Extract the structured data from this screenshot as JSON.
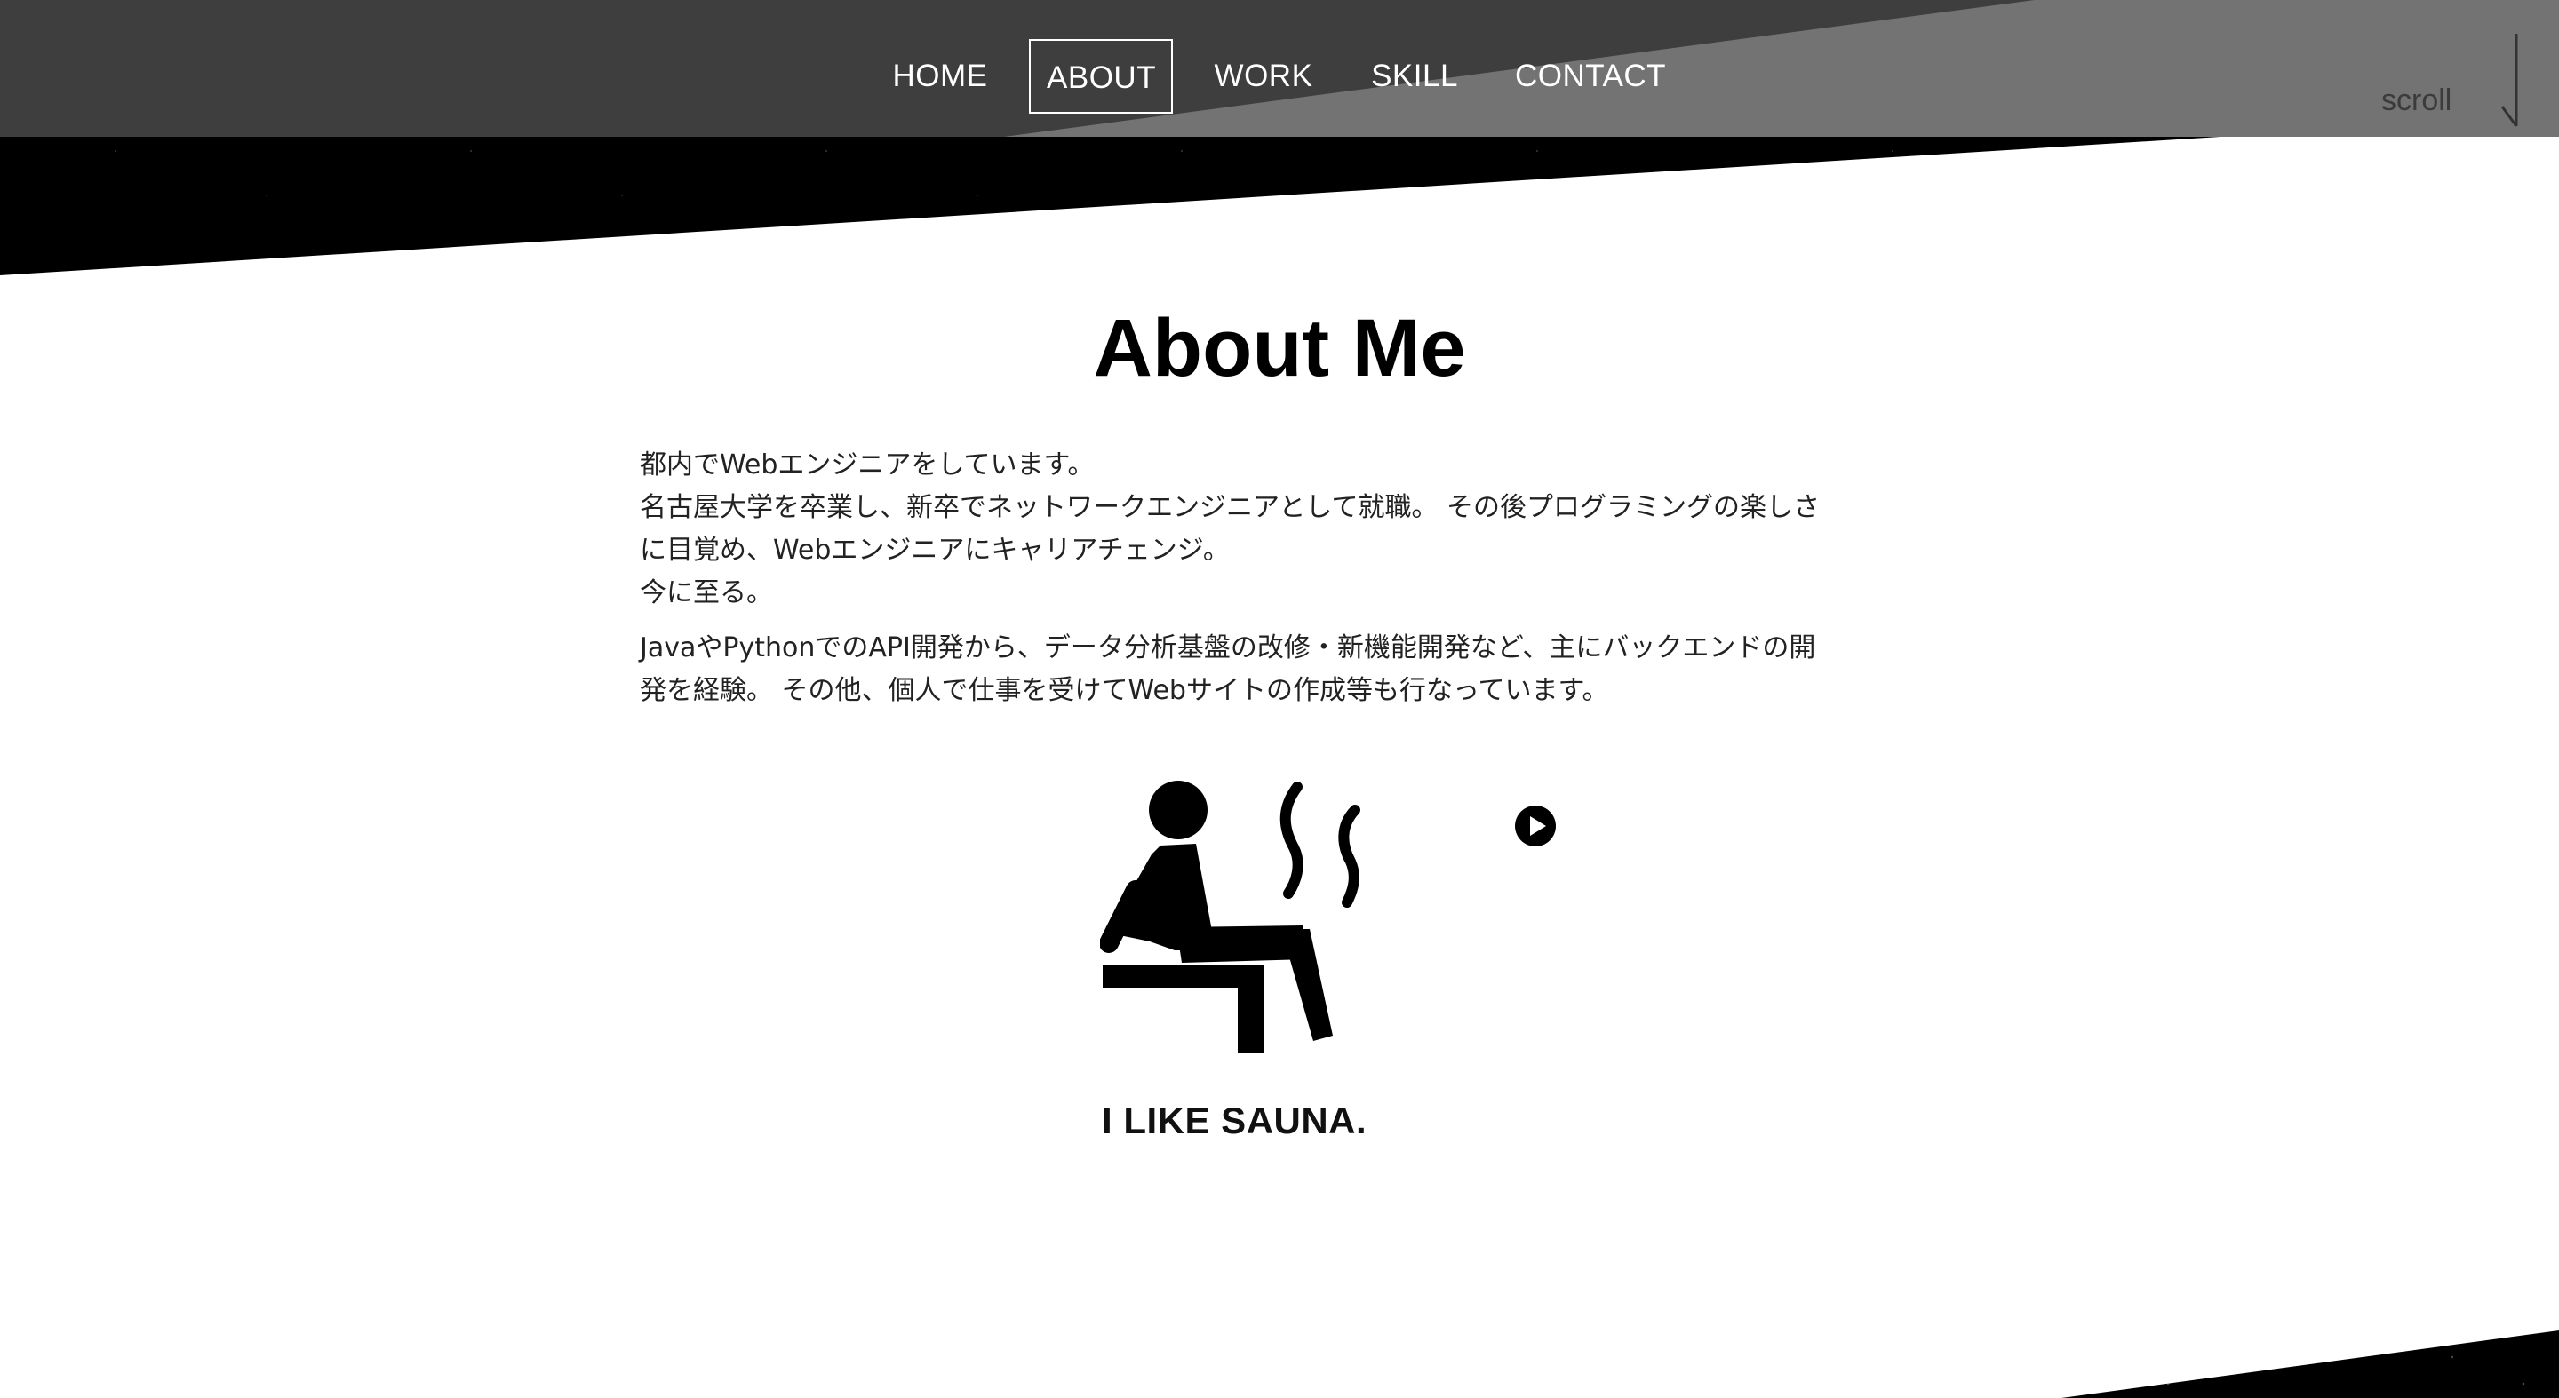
{
  "nav": {
    "items": [
      {
        "label": "HOME",
        "active": false
      },
      {
        "label": "ABOUT",
        "active": true
      },
      {
        "label": "WORK",
        "active": false
      },
      {
        "label": "SKILL",
        "active": false
      },
      {
        "label": "CONTACT",
        "active": false
      }
    ],
    "scroll_label": "scroll"
  },
  "about": {
    "title": "About Me",
    "paragraph1": [
      "都内でWebエンジニアをしています。",
      "名古屋大学を卒業し、新卒でネットワークエンジニアとして就職。 その後プログラミングの楽しさ",
      "に目覚め、Webエンジニアにキャリアチェンジ。",
      "今に至る。"
    ],
    "paragraph2": [
      "JavaやPythonでのAPI開発から、データ分析基盤の改修・新機能開発など、主にバックエンドの開",
      "発を経験。 その他、個人で仕事を受けてWebサイトの作成等も行なっています。"
    ],
    "sauna_caption": "I LIKE SAUNA."
  },
  "colors": {
    "nav_bg": "#3e3e3e",
    "nav_wedge": "#737373",
    "band": "#000000",
    "text": "#222222"
  },
  "icons": {
    "sauna": "sauna-icon",
    "play": "play-icon",
    "scroll": "scroll-arrow-icon"
  }
}
